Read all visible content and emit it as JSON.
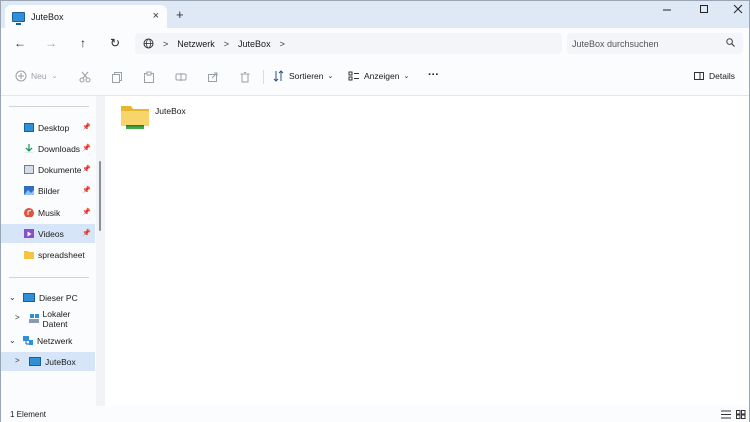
{
  "window": {
    "tab_title": "JuteBox",
    "new_tab_symbol": "+",
    "close_tab_symbol": "×"
  },
  "nav": {
    "back": "←",
    "forward": "→",
    "up": "↑",
    "refresh": "↻",
    "breadcrumbs": [
      "Netzwerk",
      "JuteBox"
    ],
    "search_placeholder": "JuteBox durchsuchen"
  },
  "toolbar": {
    "new_label": "Neu",
    "sort_label": "Sortieren",
    "view_label": "Anzeigen",
    "more_label": "···",
    "details_label": "Details"
  },
  "sidebar": {
    "quick_access": [
      {
        "label": "Desktop",
        "pinned": true,
        "color": "#2f8fd8"
      },
      {
        "label": "Downloads",
        "pinned": true,
        "color": "#1e9e5a"
      },
      {
        "label": "Dokumente",
        "pinned": true,
        "color": "#6e7f94"
      },
      {
        "label": "Bilder",
        "pinned": true,
        "color": "#2d6fc1"
      },
      {
        "label": "Musik",
        "pinned": true,
        "color": "#e0533d"
      },
      {
        "label": "Videos",
        "pinned": true,
        "color": "#8a4fc9"
      },
      {
        "label": "spreadsheet",
        "pinned": false,
        "color": "#f3c543"
      }
    ],
    "tree": [
      {
        "label": "Dieser PC",
        "expanded": true
      },
      {
        "label": "Lokaler Datent",
        "expanded": false
      },
      {
        "label": "Netzwerk",
        "expanded": true
      },
      {
        "label": "JuteBox",
        "expanded": false
      }
    ]
  },
  "content": {
    "items": [
      {
        "label": "JuteBox",
        "type": "network-folder"
      }
    ]
  },
  "status": {
    "count_text": "1 Element"
  },
  "colors": {
    "accent": "#2f8fd8",
    "selected": "#d6e6f8",
    "folder": "#f3c543"
  }
}
